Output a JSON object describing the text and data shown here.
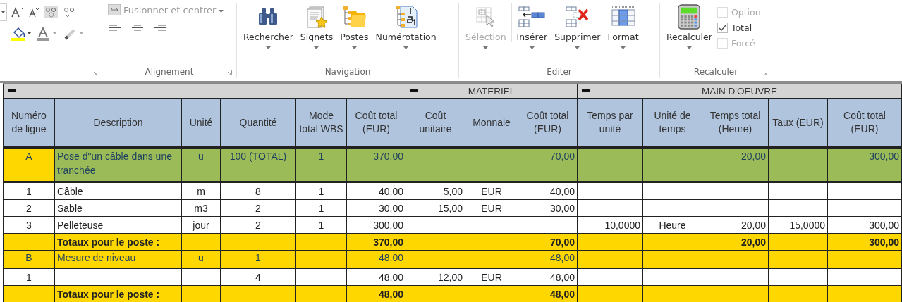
{
  "ribbon": {
    "alignment_group": {
      "label": "Alignement",
      "merge_button": {
        "label": "Fusionner et centrer",
        "disabled": true
      }
    },
    "navigation_group": {
      "label": "Navigation",
      "buttons": [
        {
          "kind": "binoculars",
          "label": "Rechercher",
          "disabled": false
        },
        {
          "kind": "bookmark",
          "label": "Signets",
          "disabled": false
        },
        {
          "kind": "folders",
          "label": "Postes",
          "disabled": false
        },
        {
          "kind": "numbering",
          "label": "Numérotation",
          "disabled": false
        }
      ]
    },
    "edit_group": {
      "label": "Editer",
      "buttons": [
        {
          "kind": "selection",
          "label": "Sélection",
          "disabled": true
        },
        {
          "kind": "insert",
          "label": "Insérer",
          "disabled": false
        },
        {
          "kind": "delete",
          "label": "Supprimer",
          "disabled": false
        },
        {
          "kind": "format",
          "label": "Format",
          "disabled": false
        }
      ]
    },
    "recalc_group": {
      "label": "Recalculer",
      "button": {
        "label": "Recalculer"
      },
      "checkboxes": [
        {
          "label": "Option",
          "checked": false,
          "disabled": true
        },
        {
          "label": "Total",
          "checked": true,
          "disabled": false
        },
        {
          "label": "Forcé",
          "checked": false,
          "disabled": true
        }
      ]
    }
  },
  "table": {
    "section_titles": [
      "MATERIEL",
      "MAIN D'OEUVRE"
    ],
    "columns": [
      "Numéro de ligne",
      "Description",
      "Unité",
      "Quantité",
      "Mode total WBS",
      "Coût total (EUR)",
      "Coût unitaire",
      "Monnaie",
      "Coût total (EUR)",
      "Temps par unité",
      "Unité de temps",
      "Temps total (Heure)",
      "Taux (EUR)",
      "Coût total (EUR)"
    ],
    "rows": [
      {
        "kind": "poste",
        "color": "#9bbb59",
        "line_number": "A",
        "description": "Pose d\"un câble dans une tranchée",
        "unit": "u",
        "quantity": "100 (TOTAL)",
        "wbs_mode": "1",
        "total_cost": "370,00",
        "material_total": "70,00",
        "total_time": "20,00",
        "labour_total": "300,00"
      },
      {
        "kind": "line",
        "line_number": "1",
        "description": "Câble",
        "unit": "m",
        "quantity": "8",
        "wbs_mode": "1",
        "total_cost": "40,00",
        "unit_cost": "5,00",
        "currency": "EUR",
        "material_total": "40,00"
      },
      {
        "kind": "line",
        "line_number": "2",
        "description": "Sable",
        "unit": "m3",
        "quantity": "2",
        "wbs_mode": "1",
        "total_cost": "30,00",
        "unit_cost": "15,00",
        "currency": "EUR",
        "material_total": "30,00"
      },
      {
        "kind": "line",
        "line_number": "3",
        "description": "Pelleteuse",
        "unit": "jour",
        "quantity": "2",
        "wbs_mode": "1",
        "total_cost": "300,00",
        "time_per_unit": "10,0000",
        "time_unit": "Heure",
        "total_time": "20,00",
        "rate": "15,0000",
        "labour_total": "300,00"
      },
      {
        "kind": "total",
        "description": "Totaux pour le poste :",
        "total_cost": "370,00",
        "material_total": "70,00",
        "total_time": "20,00",
        "labour_total": "300,00"
      },
      {
        "kind": "poste",
        "color": "#ffd700",
        "line_number": "B",
        "description": "Mesure de niveau",
        "unit": "u",
        "quantity": "1",
        "total_cost": "48,00",
        "material_total": "48,00"
      },
      {
        "kind": "line",
        "line_number": "1",
        "quantity": "4",
        "total_cost": "48,00",
        "unit_cost": "12,00",
        "currency": "EUR",
        "material_total": "48,00"
      },
      {
        "kind": "total",
        "description": "Totaux pour le poste :",
        "total_cost": "48,00",
        "material_total": "48,00"
      }
    ]
  }
}
